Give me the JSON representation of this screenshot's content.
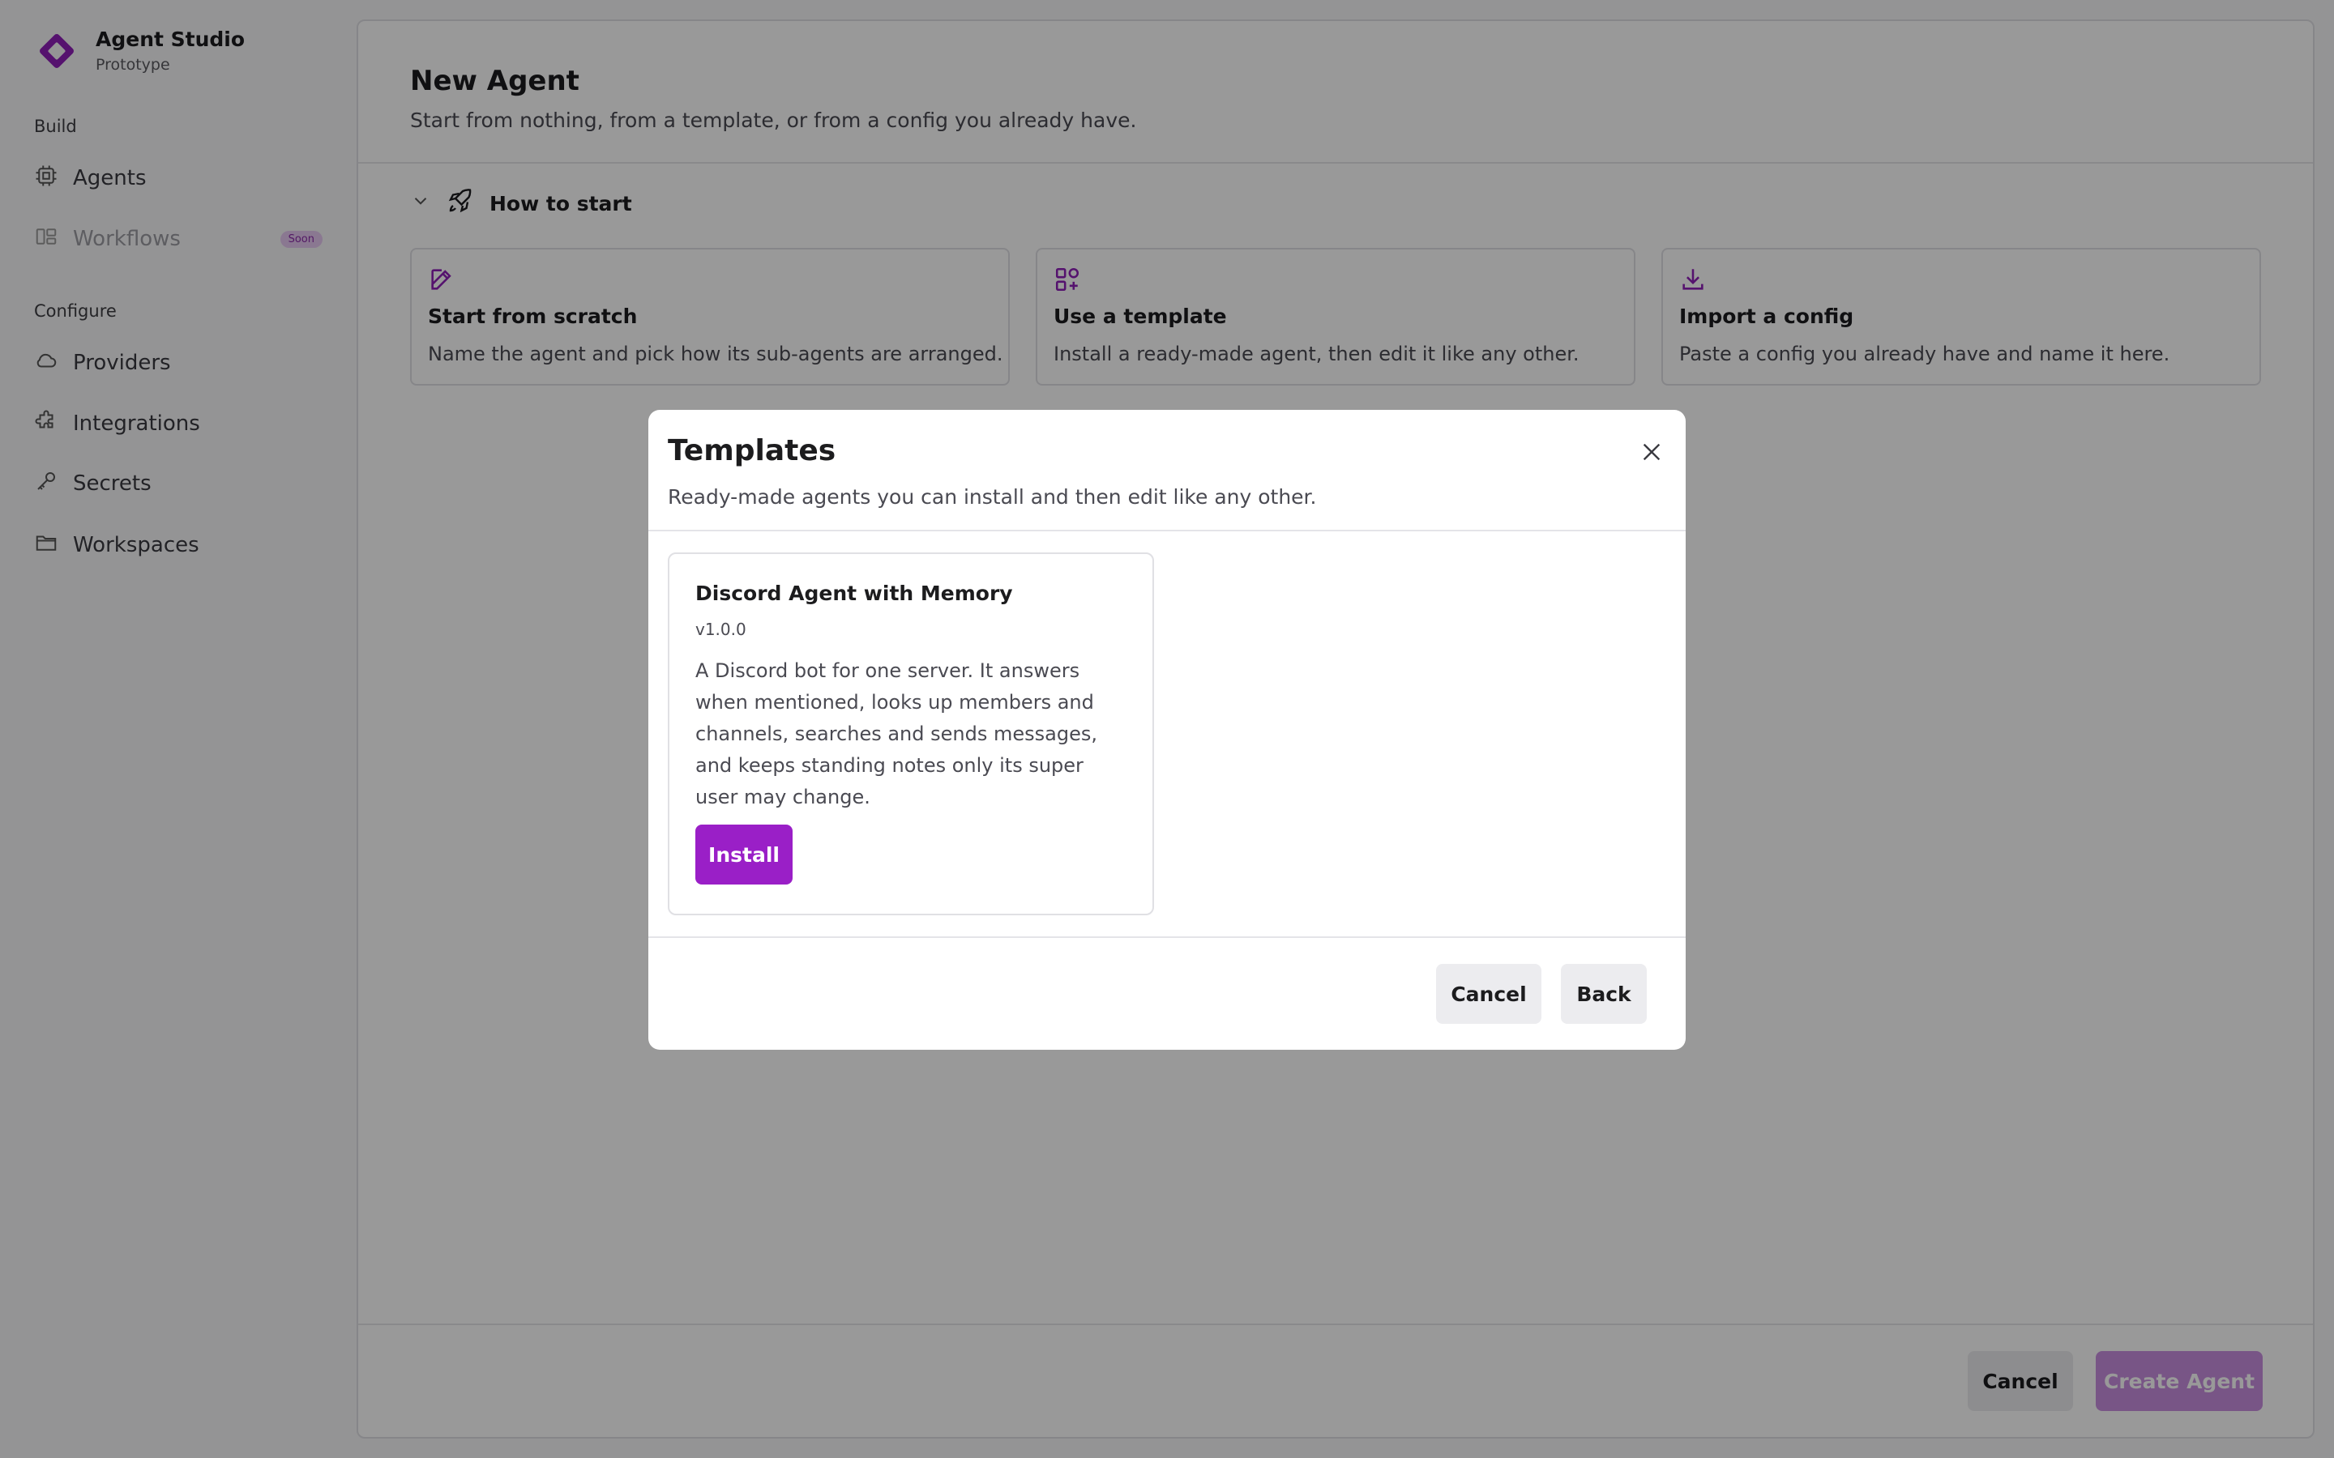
{
  "sidebar": {
    "brand_title": "Agent Studio",
    "brand_subtitle": "Prototype",
    "sections": [
      {
        "label": "Build",
        "items": [
          {
            "label": "Agents",
            "icon": "cpu-icon"
          },
          {
            "label": "Workflows",
            "icon": "workflow-icon",
            "badge": "Soon",
            "disabled": true
          }
        ]
      },
      {
        "label": "Configure",
        "items": [
          {
            "label": "Providers",
            "icon": "cloud-icon"
          },
          {
            "label": "Integrations",
            "icon": "puzzle-icon"
          },
          {
            "label": "Secrets",
            "icon": "key-icon"
          },
          {
            "label": "Workspaces",
            "icon": "folder-icon"
          }
        ]
      }
    ]
  },
  "page": {
    "title": "New Agent",
    "subtitle": "Start from nothing, from a template, or from a config you already have.",
    "how_to_start": "How to start",
    "options": [
      {
        "title": "Start from scratch",
        "description": "Name the agent and pick how its sub-agents are arranged.",
        "icon": "edit-icon"
      },
      {
        "title": "Use a template",
        "description": "Install a ready-made agent, then edit it like any other.",
        "icon": "grid-plus-icon"
      },
      {
        "title": "Import a config",
        "description": "Paste a config you already have and name it here.",
        "icon": "download-icon"
      }
    ],
    "footer": {
      "cancel_label": "Cancel",
      "create_label": "Create Agent"
    }
  },
  "modal": {
    "title": "Templates",
    "subtitle": "Ready-made agents you can install and then edit like any other.",
    "templates": [
      {
        "title": "Discord Agent with Memory",
        "version": "v1.0.0",
        "description": "A Discord bot for one server. It answers when mentioned, looks up members and channels, searches and sends messages, and keeps standing notes only its super user may change.",
        "install_label": "Install"
      }
    ],
    "cancel_label": "Cancel",
    "back_label": "Back"
  },
  "colors": {
    "accent": "#9a1fc7",
    "accent_faded": "#c98ee0",
    "overlay": "rgba(0,0,0,0.40)"
  }
}
